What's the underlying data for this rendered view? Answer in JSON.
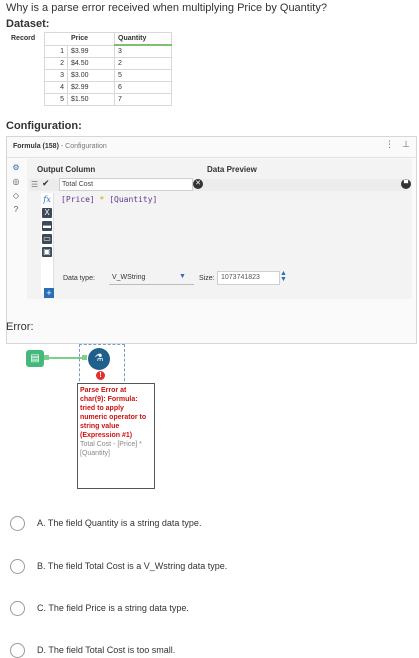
{
  "question": "Why is a parse error received when multiplying Price by Quantity?",
  "dataset_heading": "Dataset:",
  "dataset": {
    "headers": [
      "Record",
      "Price",
      "Quantity"
    ],
    "rows": [
      {
        "n": "1",
        "price": "$3.99",
        "qty": "3"
      },
      {
        "n": "2",
        "price": "$4.50",
        "qty": "2"
      },
      {
        "n": "3",
        "price": "$3.00",
        "qty": "5"
      },
      {
        "n": "4",
        "price": "$2.99",
        "qty": "6"
      },
      {
        "n": "5",
        "price": "$1.50",
        "qty": "7"
      }
    ]
  },
  "configuration_heading": "Configuration:",
  "config": {
    "title": "Formula (158)",
    "subtitle": "- Configuration",
    "output_column_header": "Output Column",
    "data_preview_header": "Data Preview",
    "output_column_value": "Total Cost",
    "expression": {
      "a": "[Price]",
      "op": "*",
      "b": "[Quantity]"
    },
    "data_type_label": "Data type:",
    "data_type_value": "V_WString",
    "size_label": "Size:",
    "size_value": "1073741823"
  },
  "error_heading": "Error:",
  "error_box": {
    "message": "Parse Error at char(9): Formula: tried to apply numeric operator to string value (Expression #1)",
    "detail": "Total Cost - [Price] * [Quantity]"
  },
  "options": [
    {
      "letter": "A.",
      "text": "The field Quantity is a string data type."
    },
    {
      "letter": "B.",
      "text": "The field Total Cost is a V_Wstring data type."
    },
    {
      "letter": "C.",
      "text": "The field Price is a string data type."
    },
    {
      "letter": "D.",
      "text": "The field Total Cost is too small."
    }
  ]
}
